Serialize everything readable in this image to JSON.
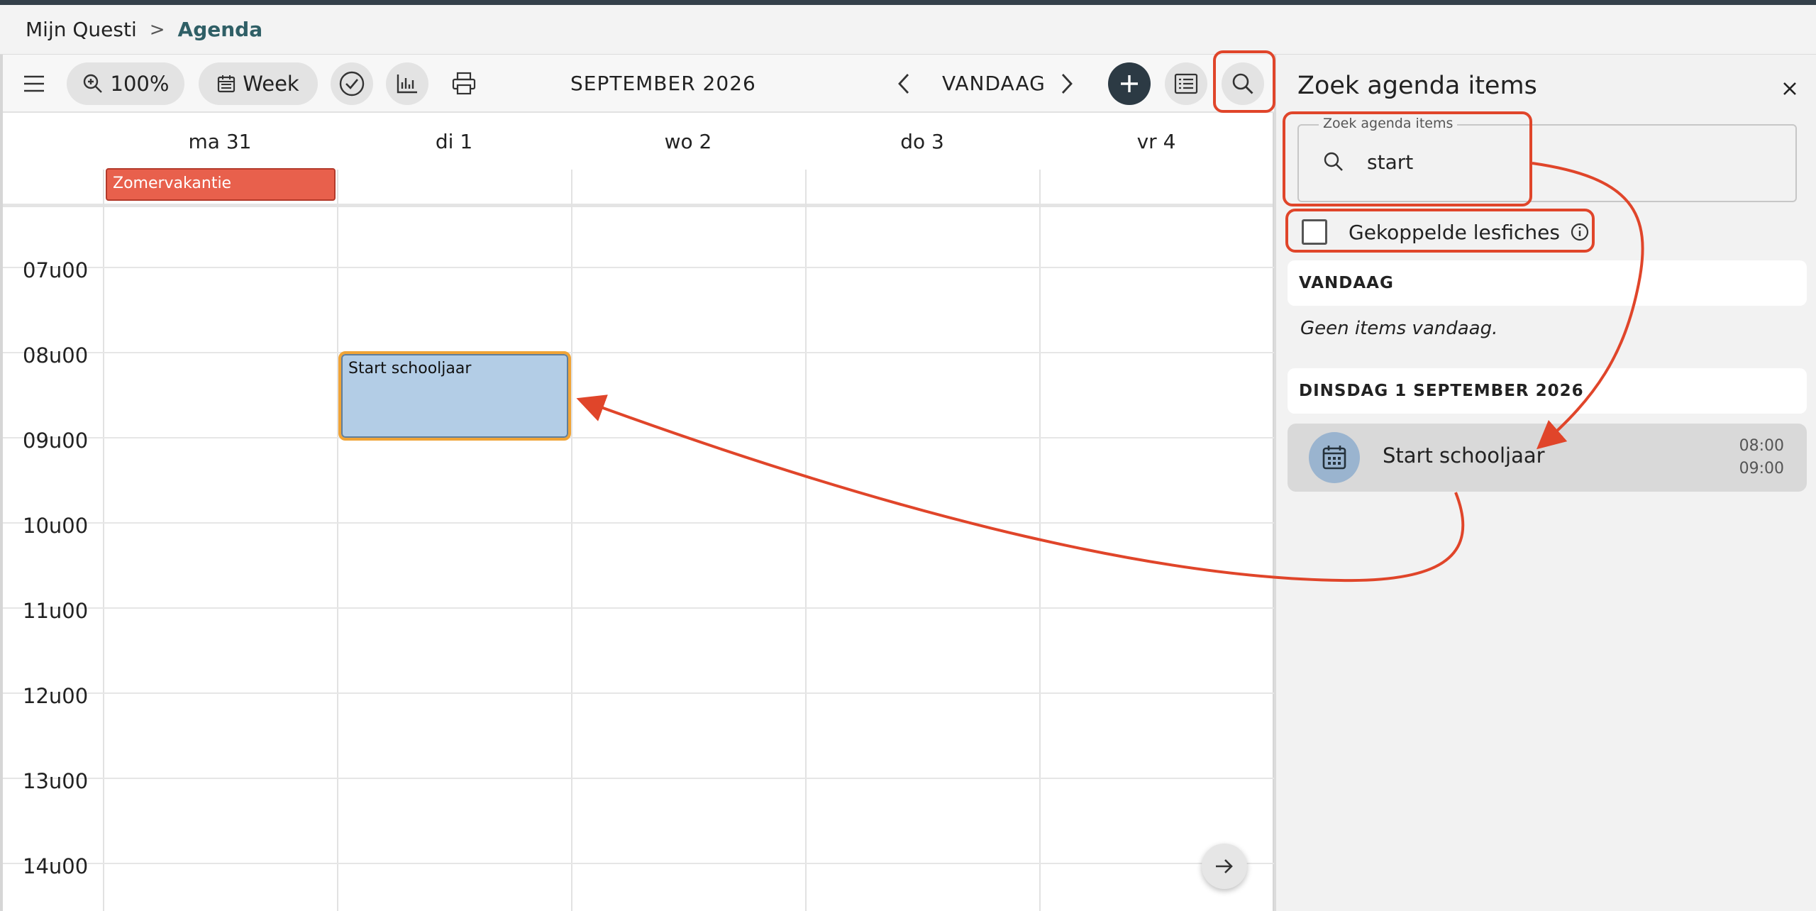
{
  "breadcrumb": {
    "root": "Mijn Questi",
    "separator": ">",
    "current": "Agenda"
  },
  "toolbar": {
    "zoom_label": "100%",
    "view_label": "Week",
    "month_label": "SEPTEMBER 2026",
    "today_label": "VANDAAG"
  },
  "calendar": {
    "days": [
      "ma 31",
      "di 1",
      "wo 2",
      "do 3",
      "vr 4"
    ],
    "hours": [
      "07u00",
      "08u00",
      "09u00",
      "10u00",
      "11u00",
      "12u00",
      "13u00",
      "14u00"
    ],
    "allday_event": "Zomervakantie",
    "event_title": "Start schooljaar"
  },
  "panel": {
    "title": "Zoek agenda items",
    "search_legend": "Zoek agenda items",
    "search_value": "start",
    "checkbox_label": "Gekoppelde lesfiches",
    "section_today": "VANDAAG",
    "empty_today": "Geen items vandaag.",
    "section_date": "DINSDAG 1 SEPTEMBER 2026",
    "result": {
      "title": "Start schooljaar",
      "start": "08:00",
      "end": "09:00"
    }
  },
  "colors": {
    "accent_dark": "#2c3a44",
    "breadcrumb_active": "#2f5f66",
    "vacation_event": "#e8604c",
    "event_fill": "#b3cde6",
    "event_border": "#f0a437",
    "annotation_red": "#e0452a"
  }
}
